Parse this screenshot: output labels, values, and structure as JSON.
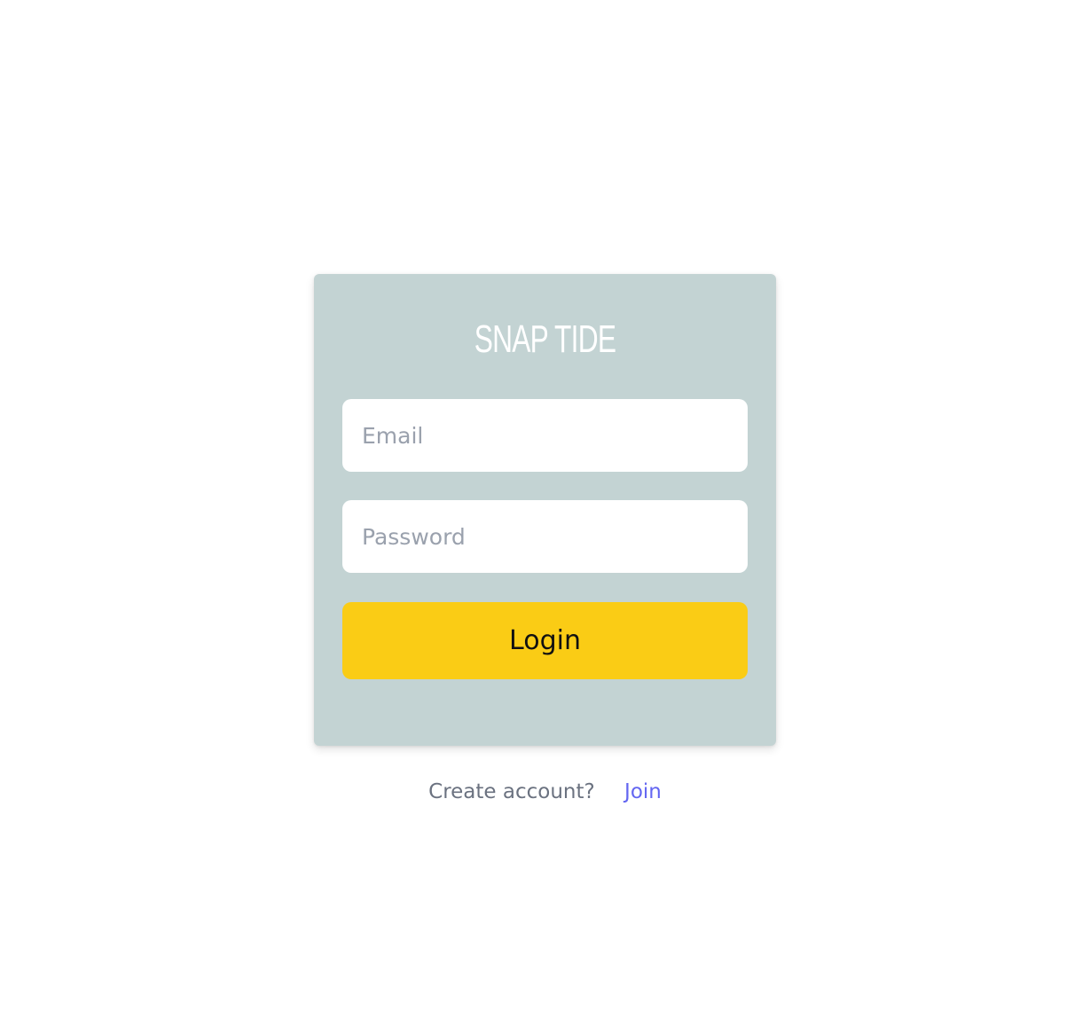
{
  "brand": {
    "title": "SNAP TIDE"
  },
  "form": {
    "email_placeholder": "Email",
    "email_value": "",
    "password_placeholder": "Password",
    "password_value": "",
    "submit_label": "Login"
  },
  "footer": {
    "prompt": "Create account?",
    "link_label": "Join"
  },
  "colors": {
    "card_background": "#c3d3d3",
    "button_background": "#facc15",
    "link": "#6366f1",
    "prompt_text": "#6b7280",
    "placeholder_text": "#9aa1ad"
  }
}
